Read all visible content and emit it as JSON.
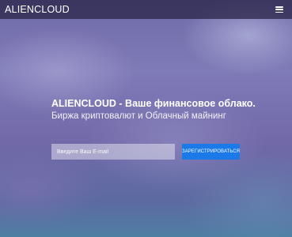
{
  "navbar": {
    "brand": "ALIENCLOUD",
    "menu_icon": "hamburger-menu-icon"
  },
  "hero": {
    "title": "ALIENCLOUD - Ваше финансовое облако.",
    "subtitle": "Биржа криптовалют и Облачный майнинг"
  },
  "signup_form": {
    "email_placeholder": "Введите Ваш E-mail",
    "email_value": "",
    "button_label": "ЗАРЕГИСТРИРОВАТЬСЯ"
  },
  "colors": {
    "navbar_background": "#2d284b",
    "button_background": "#1b7ae8",
    "text": "#ffffff"
  }
}
